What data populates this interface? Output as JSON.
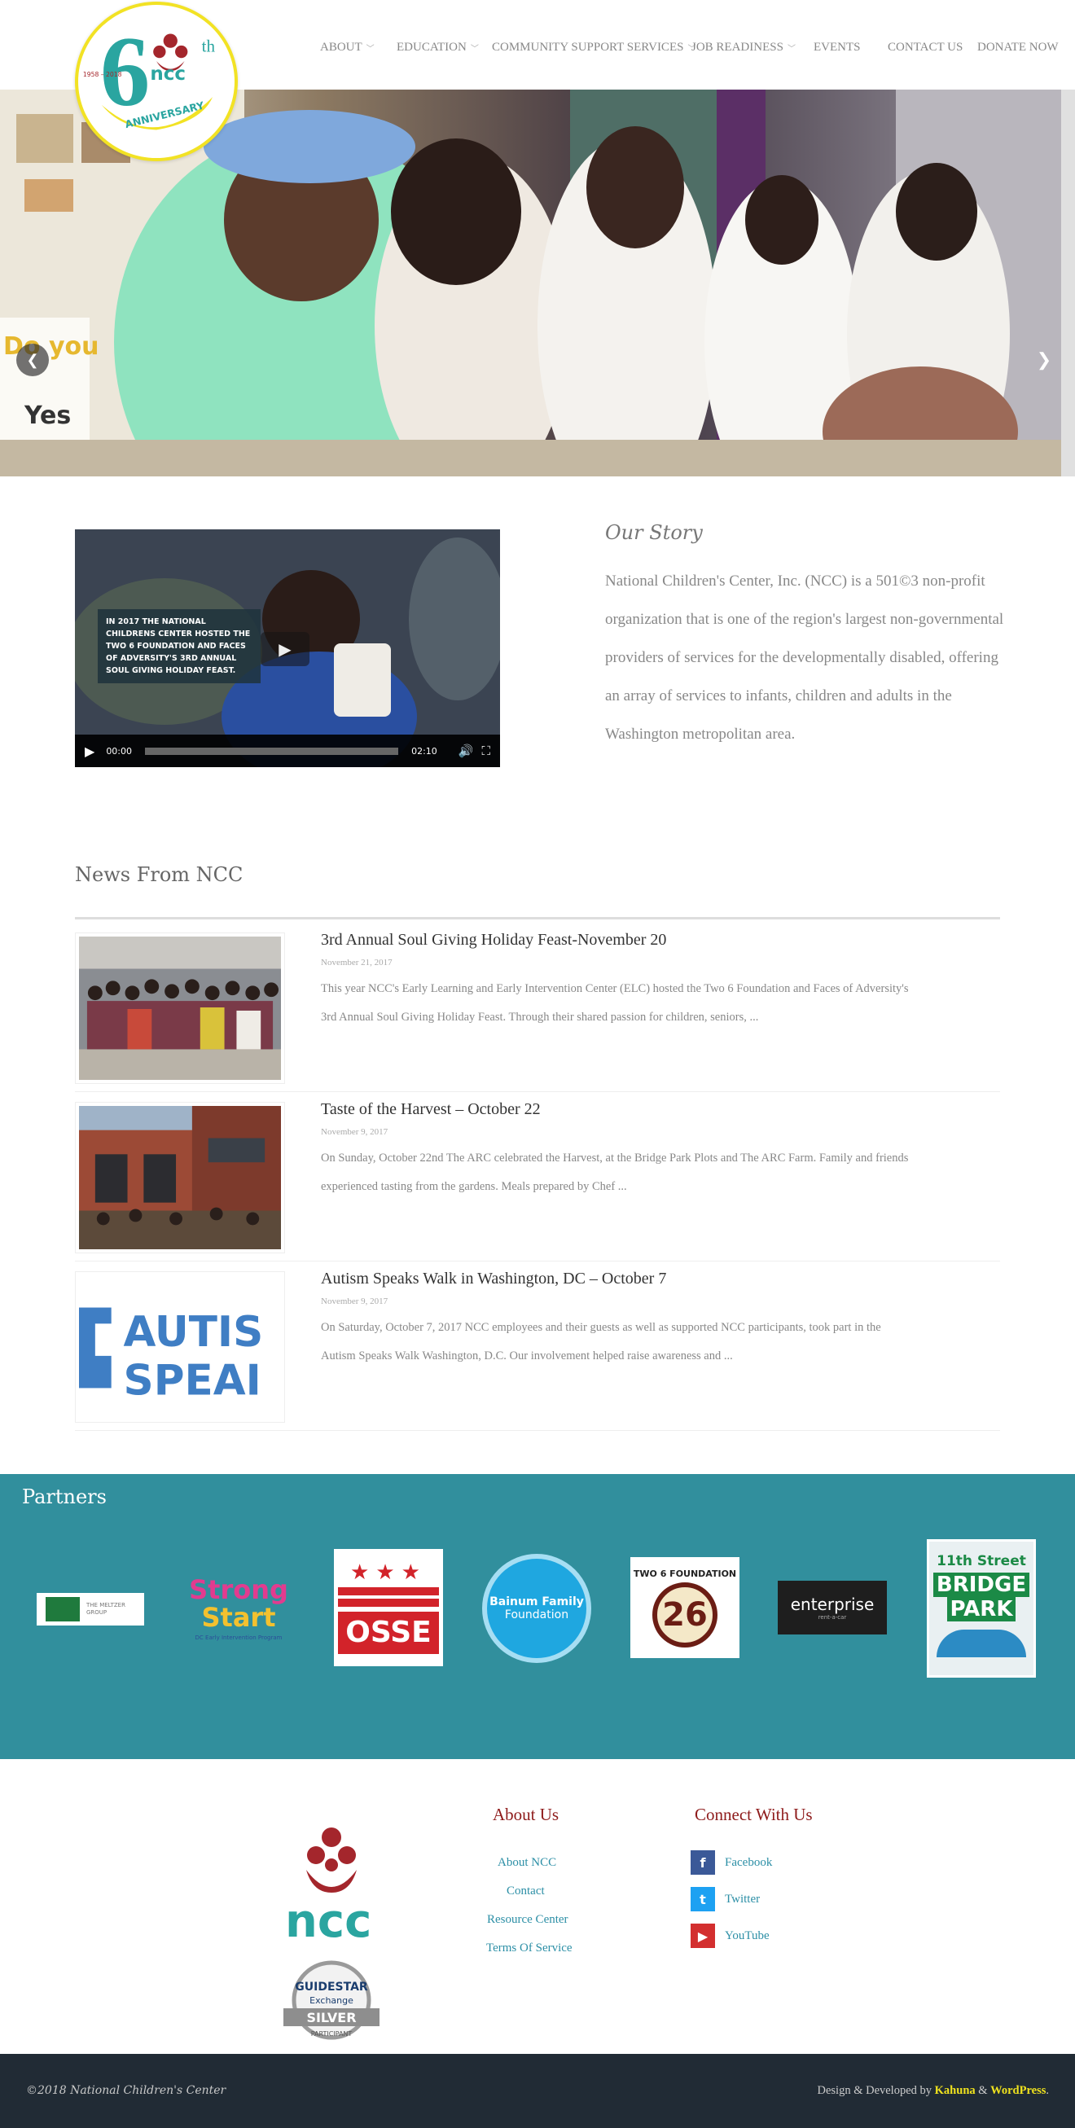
{
  "header": {
    "logo": {
      "years": "1958 – 2018",
      "big_number": "6",
      "superscript": "th",
      "brand": "ncc",
      "ribbon": "ANNIVERSARY"
    },
    "nav": [
      {
        "label": "ABOUT",
        "dropdown": true
      },
      {
        "label": "EDUCATION",
        "dropdown": true
      },
      {
        "label": "COMMUNITY SUPPORT SERVICES",
        "dropdown": true
      },
      {
        "label": "JOB READINESS",
        "dropdown": true
      },
      {
        "label": "EVENTS",
        "dropdown": false
      },
      {
        "label": "CONTACT US",
        "dropdown": false
      },
      {
        "label": "DONATE NOW",
        "dropdown": false
      }
    ]
  },
  "slider": {
    "prev_icon": "chevron-left-icon",
    "next_icon": "chevron-right-icon",
    "wall_text_1": "Do you",
    "wall_text_2": "Yes"
  },
  "story": {
    "video": {
      "caption": "IN 2017 THE NATIONAL CHILDRENS CENTER HOSTED THE TWO 6 FOUNDATION AND FACES OF ADVERSITY'S 3RD ANNUAL SOUL GIVING HOLIDAY FEAST.",
      "current_time": "00:00",
      "duration": "02:10"
    },
    "title": "Our Story",
    "text": "National Children's Center, Inc. (NCC) is a 501©3 non-profit organization that is one of the region's largest non-governmental providers of services for the developmentally disabled, offering an array of services to infants, children and adults in the Washington metropolitan area."
  },
  "news": {
    "title": "News From NCC",
    "items": [
      {
        "headline": "3rd Annual Soul Giving Holiday Feast-November 20",
        "date": "November 21, 2017",
        "excerpt": "This year NCC's Early Learning and Early Intervention Center (ELC) hosted  the Two 6 Foundation and Faces of Adversity's 3rd Annual Soul Giving Holiday Feast. Through their shared passion for children, seniors, ..."
      },
      {
        "headline": "Taste of the Harvest – October 22",
        "date": "November 9, 2017",
        "excerpt": "On Sunday, October 22nd The ARC celebrated the Harvest, at the Bridge Park Plots and The ARC Farm. Family and friends experienced tasting from the gardens. Meals prepared by Chef ..."
      },
      {
        "headline": "Autism Speaks Walk in Washington, DC – October 7",
        "date": "November 9, 2017",
        "excerpt": "On Saturday, October 7, 2017 NCC employees and their guests as well as supported NCC participants, took part in the Autism Speaks Walk Washington, D.C. Our involvement helped raise awareness and ...",
        "thumb_text_1": "AUTIS",
        "thumb_text_2": "SPEAI"
      }
    ]
  },
  "partners": {
    "title": "Partners",
    "logos": [
      {
        "name": "THE MELTZER GROUP"
      },
      {
        "name": "Strong Start",
        "line1": "Strong",
        "line2": "Start",
        "sub": "DC Early Intervention Program"
      },
      {
        "name": "OSSE"
      },
      {
        "name": "Bainum Family Foundation",
        "line1": "Bainum Family",
        "line2": "Foundation"
      },
      {
        "name": "TWO 6 FOUNDATION",
        "number": "26"
      },
      {
        "name": "enterprise",
        "sub": "rent-a-car"
      },
      {
        "name": "11th Street Bridge Park",
        "line1": "11th Street",
        "line2": "BRIDGE",
        "line3": "PARK"
      }
    ]
  },
  "footer": {
    "logo_text": "ncc",
    "badge": {
      "line1": "GUIDESTAR",
      "line2": "Exchange",
      "line3": "SILVER",
      "line4": "PARTICIPANT"
    },
    "about_heading": "About Us",
    "about_links": [
      "About NCC",
      "Contact",
      "Resource Center",
      "Terms Of Service"
    ],
    "connect_heading": "Connect With Us",
    "social": [
      {
        "label": "Facebook",
        "icon": "facebook-icon",
        "color": "#3b5998"
      },
      {
        "label": "Twitter",
        "icon": "twitter-icon",
        "color": "#1da1f2"
      },
      {
        "label": "YouTube",
        "icon": "youtube-icon",
        "color": "#d32f2f"
      }
    ]
  },
  "bottom_bar": {
    "copyright": "©2018 National Children's Center",
    "credits_prefix": "Design & Developed by ",
    "credit_1": "Kahuna",
    "credits_amp": " & ",
    "credit_2": "WordPress",
    "credits_suffix": "."
  },
  "colors": {
    "partners_bg": "#318f9d",
    "footer_heading": "#8e1b1b",
    "link": "#2c8fa6",
    "bottom_bar": "#212b35",
    "credit_highlight": "#f0e21e"
  }
}
